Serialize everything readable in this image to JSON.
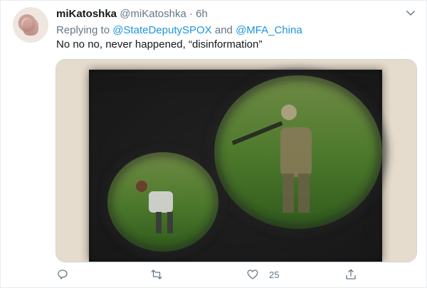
{
  "tweet": {
    "display_name": "miKatoshka",
    "handle": "@miKatoshka",
    "separator": "·",
    "time": "6h",
    "replying_prefix": "Replying to",
    "mention_1": "@StateDeputySPOX",
    "conjunction": "and",
    "mention_2": "@MFA_China",
    "text": "No no no, never happened, “disinformation”"
  },
  "actions": {
    "reply_icon": "reply-icon",
    "retweet_icon": "retweet-icon",
    "like_icon": "heart-icon",
    "like_count": "25",
    "share_icon": "share-icon"
  },
  "colors": {
    "accent": "#1b95e0",
    "muted": "#657786",
    "text": "#14171a"
  }
}
